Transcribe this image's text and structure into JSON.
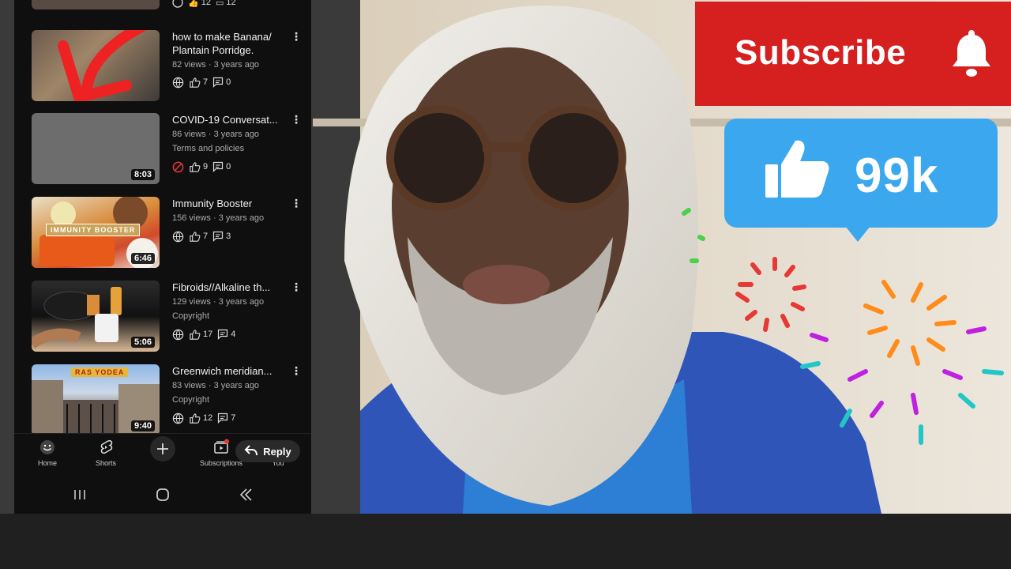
{
  "videos": [
    {
      "title_line1": "how to make Banana/",
      "title_line2": "Plantain Porridge.",
      "meta": "82 views · 3 years ago",
      "extra": "",
      "duration": "",
      "likes": "7",
      "comments": "0",
      "visibility": "globe-icon"
    },
    {
      "title_line1": "COVID-19 Conversat...",
      "title_line2": "",
      "meta": "86 views · 3 years ago",
      "extra": "Terms and policies",
      "duration": "8:03",
      "likes": "9",
      "comments": "0",
      "visibility": "blocked-icon"
    },
    {
      "title_line1": "Immunity Booster",
      "title_line2": "",
      "meta": "156 views · 3 years ago",
      "extra": "",
      "duration": "6:46",
      "likes": "7",
      "comments": "3",
      "visibility": "globe-icon",
      "thumb_text": "IMMUNITY BOOSTER"
    },
    {
      "title_line1": "Fibroids//Alkaline th...",
      "title_line2": "",
      "meta": "129 views · 3 years ago",
      "extra": "Copyright",
      "duration": "5:06",
      "likes": "17",
      "comments": "4",
      "visibility": "globe-icon"
    },
    {
      "title_line1": "Greenwich meridian...",
      "title_line2": "",
      "meta": "83 views · 3 years ago",
      "extra": "Copyright",
      "duration": "9:40",
      "likes": "12",
      "comments": "7",
      "visibility": "globe-icon",
      "thumb_text": "RAS YODEA"
    }
  ],
  "top_partial": {
    "likes": "12",
    "comments": "12"
  },
  "nav": {
    "home": "Home",
    "shorts": "Shorts",
    "subscriptions": "Subscriptions",
    "you": "You",
    "reply": "Reply"
  },
  "overlay": {
    "subscribe": "Subscribe",
    "like_count": "99k"
  },
  "colors": {
    "subscribe_red": "#d61f1f",
    "like_blue": "#3ba7ee",
    "hoodie_blue": "#2f55b8",
    "phone_bg": "#0f0f0f"
  }
}
